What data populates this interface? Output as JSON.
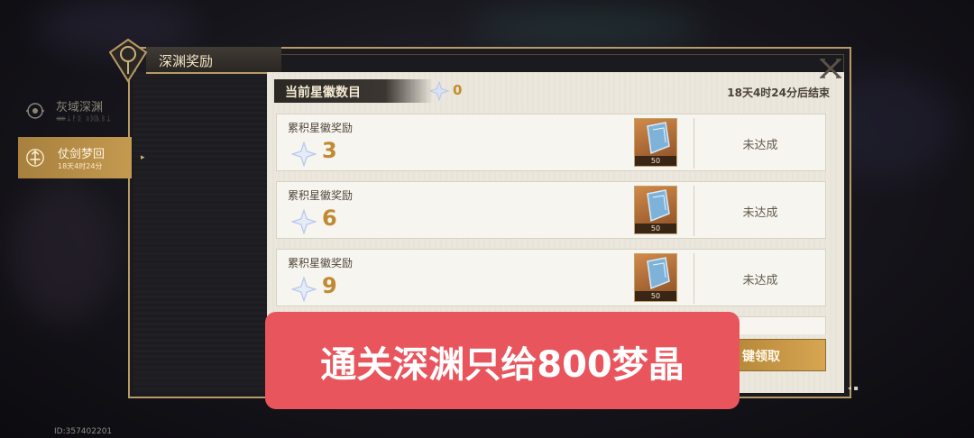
{
  "header": {
    "title": "深渊奖励"
  },
  "sidebar": {
    "items": [
      {
        "label": "灰域深渊",
        "sub": "ᚔᛦᚹᛝ ᛟᛞᚣᛒᛣ",
        "active": false
      },
      {
        "label": "仗剑梦回",
        "sub": "18天4时24分",
        "active": true
      }
    ]
  },
  "main": {
    "current_label": "当前星徽数目",
    "current_count": "0",
    "time_remaining": "18天4时24分后结束",
    "rewards": [
      {
        "label": "累积星徽奖励",
        "stars": "3",
        "item_qty": "50",
        "status": "未达成"
      },
      {
        "label": "累积星徽奖励",
        "stars": "6",
        "item_qty": "50",
        "status": "未达成"
      },
      {
        "label": "累积星徽奖励",
        "stars": "9",
        "item_qty": "50",
        "status": "未达成"
      }
    ],
    "claim_all_label": "键领取"
  },
  "overlay": {
    "text": "通关深渊只给800梦晶"
  },
  "footer": {
    "player_id": "ID:357402201"
  },
  "colors": {
    "accent_gold": "#c28e2c",
    "panel_bg": "#ebe7dc",
    "overlay_red": "#e9555d"
  },
  "icons": [
    "emblem-icon",
    "abyss-icon",
    "sword-icon",
    "star-icon",
    "crystal-icon",
    "close-icon"
  ]
}
